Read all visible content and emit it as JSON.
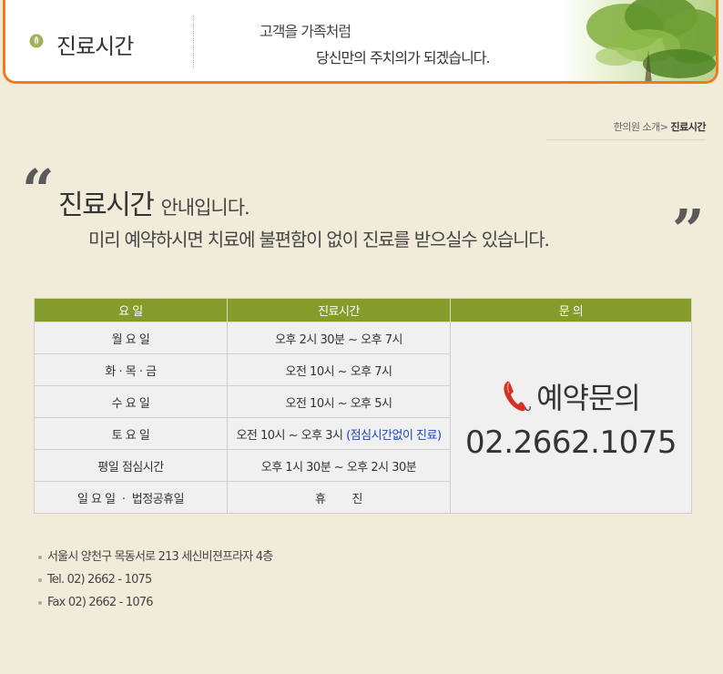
{
  "header": {
    "title": "진료시간",
    "slogan_line1": "고객을 가족처럼",
    "slogan_line2": "당신만의 주치의가 되겠습니다."
  },
  "breadcrumb": {
    "parent": "한의원 소개>",
    "current": "진료시간"
  },
  "intro": {
    "title": "진료시간",
    "title_rest": "안내입니다.",
    "line2": "미리 예약하시면 치료에 불편함이 없이 진료를 받으실수 있습니다."
  },
  "table": {
    "headers": [
      "요 일",
      "진료시간",
      "문 의"
    ],
    "rows": [
      {
        "day": "월 요 일",
        "time": "오후 2시 30분 ~ 오후 7시"
      },
      {
        "day": "화 · 목 · 금",
        "time": "오전 10시 ~ 오후 7시"
      },
      {
        "day": "수 요 일",
        "time": "오전 10시 ~ 오후 5시"
      },
      {
        "day": "토 요 일",
        "time": "오전 10시 ~ 오후 3시",
        "note": "(점심시간없이 진료)"
      },
      {
        "day": "평일 점심시간",
        "time": "오후 1시  30분 ~ 오후 2시 30분"
      },
      {
        "day": "일 요 일  ·  법정공휴일",
        "time": "휴        진"
      }
    ],
    "contact_label": "예약문의",
    "contact_phone": "02.2662.1075"
  },
  "address": {
    "line1": "서울시 양천구 목동서로 213 세신비젼프라자 4층",
    "tel": "Tel. 02) 2662 - 1075",
    "fax": "Fax 02) 2662 - 1076"
  },
  "colors": {
    "header_border": "#ec7b22",
    "table_header": "#839c2a",
    "background": "#f1ecd9",
    "lunch_text": "#3c7a1e",
    "holiday_text": "#d42121",
    "note_text": "#1a46b8"
  },
  "icons": [
    "leaf-icon",
    "tree-image",
    "quote-open-icon",
    "quote-close-icon",
    "phone-icon"
  ]
}
